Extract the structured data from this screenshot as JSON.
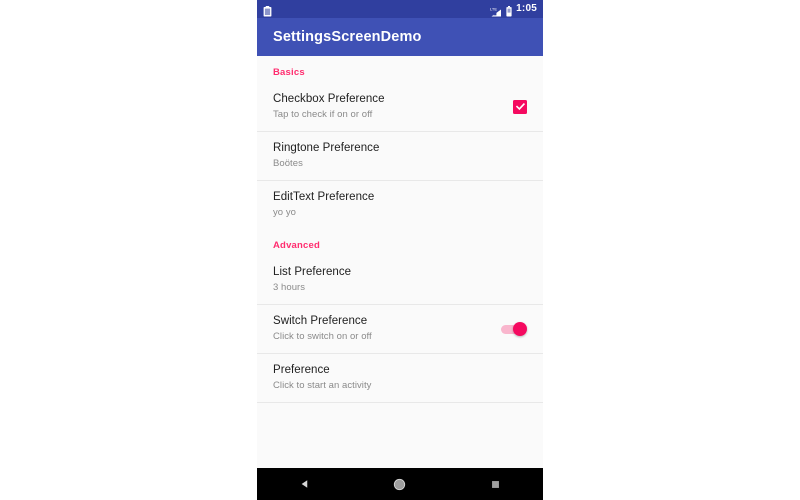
{
  "theme": {
    "app_bar_color": "#3f51b5",
    "status_bar_color": "#303f9f",
    "accent_color": "#ff2d6f",
    "widget_color": "#f50a60",
    "content_background": "#fafafa",
    "nav_bar_color": "#000000"
  },
  "status_bar": {
    "time": "1:05",
    "icons": {
      "notification": "clipboard-icon",
      "signal": "lte-signal-icon",
      "battery": "battery-icon"
    }
  },
  "app_bar": {
    "title": "SettingsScreenDemo"
  },
  "preferences": {
    "categories": [
      {
        "label": "Basics",
        "items": [
          {
            "title": "Checkbox Preference",
            "summary": "Tap to check if on or off",
            "widget": "checkbox",
            "widget_state": "checked"
          },
          {
            "title": "Ringtone Preference",
            "summary": "Boötes",
            "widget": "none",
            "widget_state": ""
          },
          {
            "title": "EditText Preference",
            "summary": "yo yo",
            "widget": "none",
            "widget_state": ""
          }
        ]
      },
      {
        "label": "Advanced",
        "items": [
          {
            "title": "List Preference",
            "summary": "3 hours",
            "widget": "none",
            "widget_state": ""
          },
          {
            "title": "Switch Preference",
            "summary": "Click to switch on or off",
            "widget": "switch",
            "widget_state": "on"
          },
          {
            "title": "Preference",
            "summary": "Click to start an activity",
            "widget": "none",
            "widget_state": ""
          }
        ]
      }
    ]
  },
  "nav_bar": {
    "buttons": [
      {
        "name": "back-button",
        "icon": "triangle-back-icon"
      },
      {
        "name": "home-button",
        "icon": "circle-home-icon"
      },
      {
        "name": "recents-button",
        "icon": "square-recents-icon"
      }
    ]
  }
}
